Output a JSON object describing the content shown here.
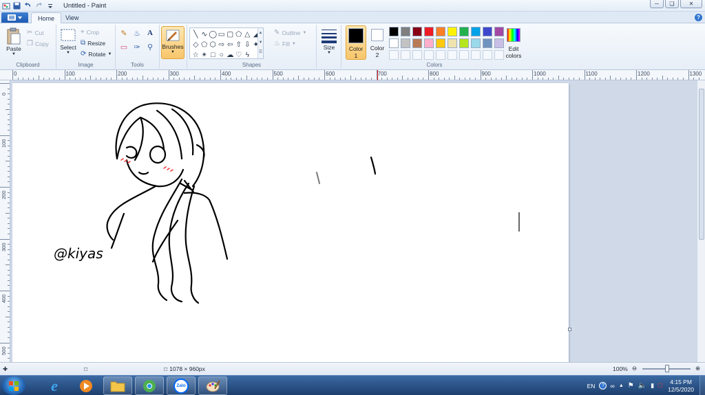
{
  "window": {
    "title": "Untitled - Paint"
  },
  "tabs": {
    "home": "Home",
    "view": "View"
  },
  "clipboard": {
    "paste": "Paste",
    "cut": "Cut",
    "copy": "Copy",
    "label": "Clipboard"
  },
  "image": {
    "select": "Select",
    "crop": "Crop",
    "resize": "Resize",
    "rotate": "Rotate",
    "label": "Image"
  },
  "tools": {
    "label": "Tools"
  },
  "brushes": {
    "label": "Brushes"
  },
  "shapes": {
    "outline": "Outline",
    "fill": "Fill",
    "label": "Shapes"
  },
  "size": {
    "label": "Size"
  },
  "colors": {
    "color1_line1": "Color",
    "color1_line2": "1",
    "color2_line1": "Color",
    "color2_line2": "2",
    "edit_line1": "Edit",
    "edit_line2": "colors",
    "label": "Colors",
    "color1_value": "#000000",
    "color2_value": "#ffffff",
    "palette": [
      "#000000",
      "#7f7f7f",
      "#880015",
      "#ed1c24",
      "#ff7f27",
      "#fff200",
      "#22b14c",
      "#00a2e8",
      "#3f48cc",
      "#a349a4",
      "#ffffff",
      "#c3c3c3",
      "#b97a57",
      "#ffaec9",
      "#ffc90e",
      "#efe4b0",
      "#b5e61d",
      "#99d9ea",
      "#7092be",
      "#c8bfe7"
    ]
  },
  "ruler": {
    "top": [
      "0",
      "100",
      "200",
      "300",
      "400",
      "500",
      "600",
      "700",
      "800",
      "900",
      "1000",
      "1100",
      "1200",
      "1300"
    ],
    "left": [
      "0",
      "100",
      "200",
      "300",
      "400",
      "500"
    ]
  },
  "canvas": {
    "signature": "@kiyas"
  },
  "status": {
    "dimensions": "1078 × 960px",
    "zoom": "100%"
  },
  "tray": {
    "lang": "EN",
    "time": "4:15 PM",
    "date": "12/5/2020"
  },
  "taskbar": {
    "zalo": "Zalo"
  }
}
